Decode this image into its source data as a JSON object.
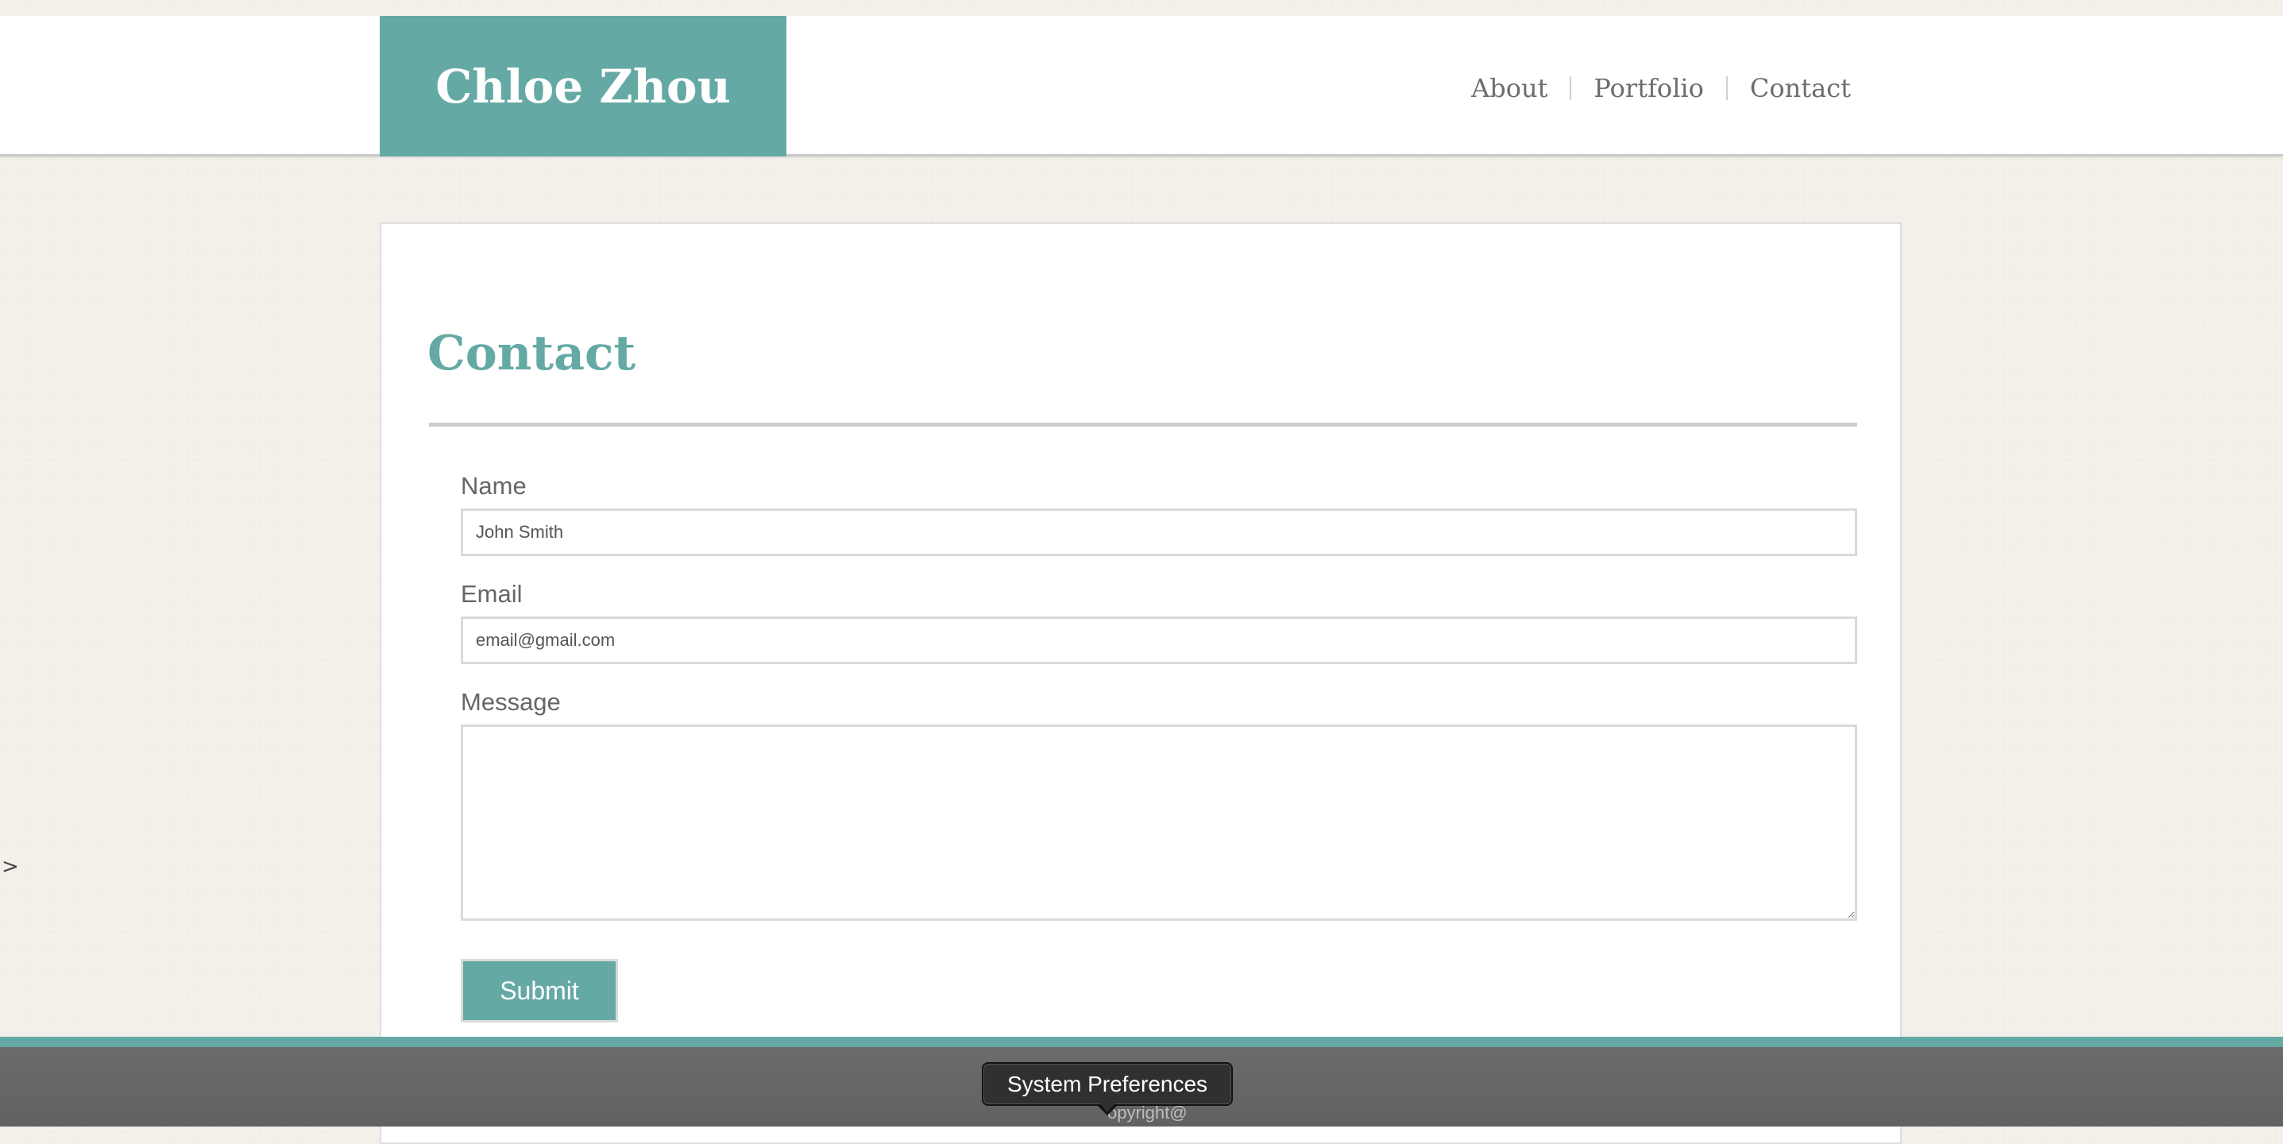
{
  "header": {
    "logo_text": "Chloe Zhou",
    "nav": [
      {
        "label": "About"
      },
      {
        "label": "Portfolio"
      },
      {
        "label": "Contact"
      }
    ]
  },
  "main": {
    "title": "Contact",
    "form": {
      "name_label": "Name",
      "name_placeholder": "John Smith",
      "email_label": "Email",
      "email_placeholder": "email@gmail.com",
      "message_label": "Message",
      "message_value": "",
      "submit_label": "Submit"
    }
  },
  "side_arrow": ">",
  "footer": {
    "copyright": "opyright@"
  },
  "tooltip": {
    "text": "System Preferences"
  },
  "colors": {
    "accent": "#65a9a5",
    "background": "#f3f0e9",
    "footer": "#666666"
  }
}
